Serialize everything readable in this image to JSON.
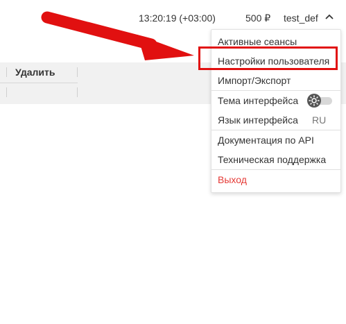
{
  "header": {
    "time": "13:20:19 (+03:00)",
    "balance": "500 ₽",
    "username": "test_def"
  },
  "toolbar": {
    "delete_label": "Удалить"
  },
  "user_menu": {
    "items": [
      {
        "label": "Активные сеансы"
      },
      {
        "label": "Настройки пользователя"
      },
      {
        "label": "Импорт/Экспорт"
      },
      {
        "label": "Тема интерфейса"
      },
      {
        "label": "Язык интерфейса"
      },
      {
        "label": "Документация по API"
      },
      {
        "label": "Техническая поддержка"
      },
      {
        "label": "Выход"
      }
    ],
    "language_value": "RU",
    "theme_toggle_icon": "sun-icon",
    "highlighted_item": "Настройки пользователя"
  },
  "annotation": {
    "arrow_color": "#e11010",
    "highlight_color": "#e11010"
  },
  "colors": {
    "logout": "#e53935",
    "toolbar_bg": "#f1f1f1"
  }
}
